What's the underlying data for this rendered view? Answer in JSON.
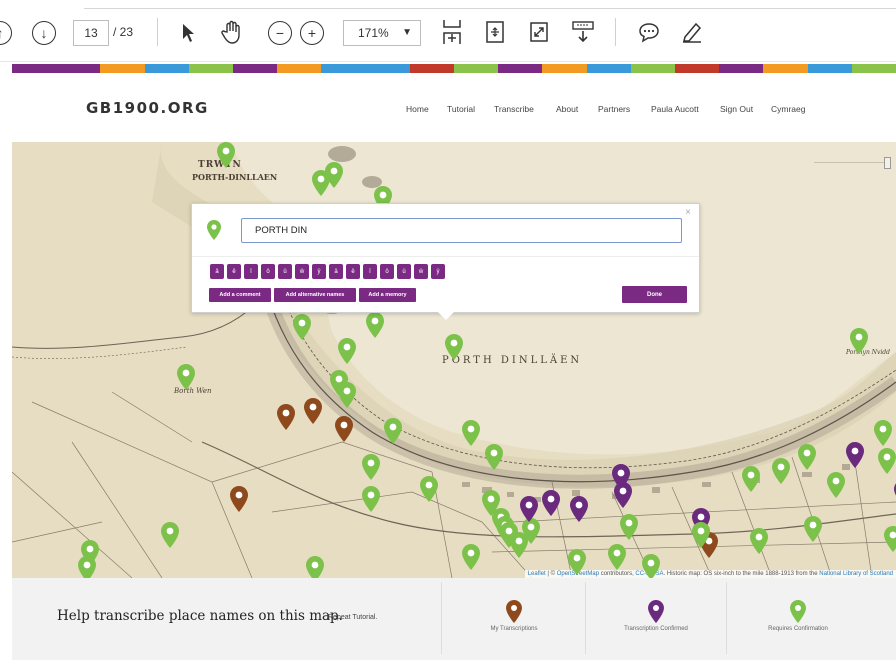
{
  "pdf_toolbar": {
    "page_current": "13",
    "page_total": "/ 23",
    "zoom": "171%"
  },
  "stripe_colors": [
    "#7b2a84",
    "#7b2a84",
    "#f39a22",
    "#3a9ad9",
    "#8bc34a",
    "#7b2a84",
    "#f39a22",
    "#3a9ad9",
    "#3a9ad9",
    "#c0392b",
    "#8bc34a",
    "#7b2a84",
    "#f39a22",
    "#3a9ad9",
    "#8bc34a",
    "#c0392b",
    "#7b2a84",
    "#f39a22",
    "#3a9ad9",
    "#8bc34a"
  ],
  "site": {
    "logo": "GB1900.ORG",
    "nav": [
      "Home",
      "Tutorial",
      "Transcribe",
      "About",
      "Partners",
      "Paula Aucott",
      "Sign Out",
      "Cymraeg"
    ]
  },
  "map": {
    "labels": {
      "trwyn": "TRWYN",
      "porth_dinllaen_headland": "PORTH-DINLLAEN",
      "porth_dinllaen_bay": "PORTH   DINLLÄEN",
      "borth_wen": "Borth Wen",
      "porthyn_nvidd": "Porthyn Nvidd"
    },
    "attribution": {
      "leaflet": "Leaflet",
      "osm": "OpenStreetMap",
      "contributors": "contributors,",
      "license": "CC-BY-SA",
      "rest": ". Historic map: OS six-inch to the mile 1888-1913 from the",
      "nls": "National Library of Scotland"
    }
  },
  "popup": {
    "input_value": "PORTH DIN",
    "special_keys": [
      "â",
      "ê",
      "î",
      "ô",
      "û",
      "ŵ",
      "ŷ",
      "ä",
      "ë",
      "ï",
      "ö",
      "ü",
      "ẅ",
      "ÿ"
    ],
    "add_comment": "Add a comment",
    "add_alt_names": "Add alternative names",
    "add_memory": "Add a memory",
    "done": "Done",
    "close": "×"
  },
  "footer": {
    "help_text": "Help transcribe place names on this map.",
    "repeat_tutorial": "Repeat Tutorial.",
    "legend": [
      {
        "label": "My Transcriptions",
        "color": "#8e4a1c"
      },
      {
        "label": "Transcription Confirmed",
        "color": "#6a2a7e"
      },
      {
        "label": "Requires Confirmation",
        "color": "#7cc24a"
      }
    ]
  },
  "pin_colors": {
    "green": "#7cc24a",
    "purple": "#6a2a7e",
    "brown": "#8e4a1c"
  }
}
